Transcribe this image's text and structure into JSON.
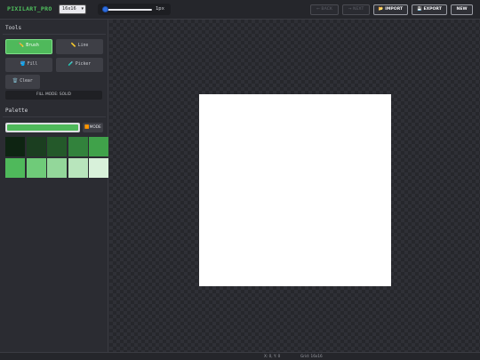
{
  "app": {
    "title_main": "PIXILART",
    "title_suffix": "_PRO"
  },
  "toolbar": {
    "size_select": "16x16",
    "brush_size": "1px",
    "brush_value": 1,
    "brush_fill": 0.05,
    "buttons": {
      "back": "← BACK",
      "next": "→ NEXT",
      "import": "📂 IMPORT",
      "export": "💾 EXPORT",
      "new": "NEW"
    }
  },
  "sidebar": {
    "tools_title": "Tools",
    "tools": [
      {
        "icon": "✏️",
        "label": "Brush"
      },
      {
        "icon": "📏",
        "label": "Line"
      },
      {
        "icon": "🪣",
        "label": "Fill"
      },
      {
        "icon": "🧪",
        "label": "Picker"
      },
      {
        "icon": "🗑️",
        "label": "Clear"
      }
    ],
    "fill_mode": "FILL MODE: SOLID",
    "palette_title": "Palette",
    "current_color": "#4fb95b",
    "mode_button": {
      "icon": "🟧",
      "label": "MODE"
    },
    "palette": [
      "#0e2412",
      "#1b3e20",
      "#24592a",
      "#32823c",
      "#40a24a",
      "#4fb95b",
      "#6fcb79",
      "#93d79a",
      "#b8e5bc",
      "#d8f1da"
    ]
  },
  "status": {
    "coords": "X: 0, Y: 0",
    "grid": "Grid: 16x16"
  }
}
